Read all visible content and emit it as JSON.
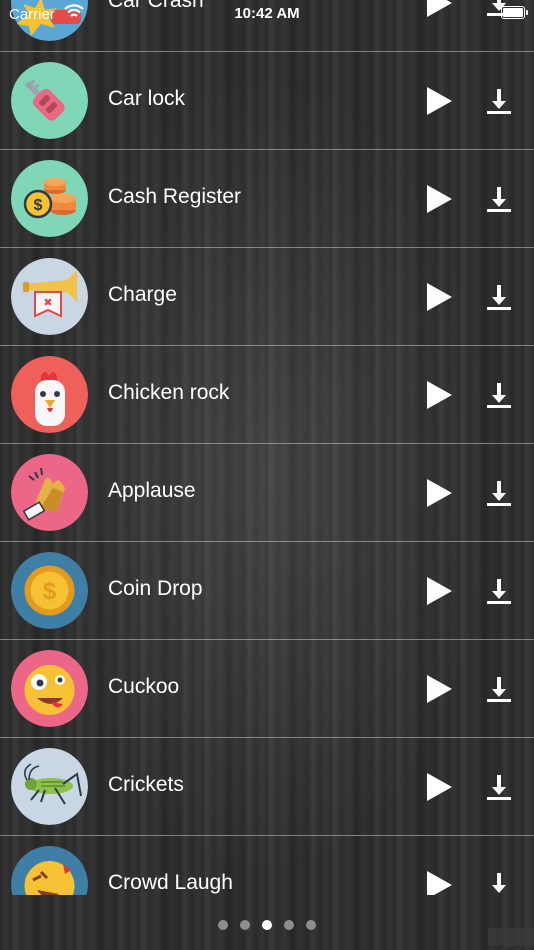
{
  "status_bar": {
    "carrier": "Carrier",
    "time": "10:42 AM"
  },
  "sounds": [
    {
      "label": "Car Crash",
      "icon": "car-crash-icon"
    },
    {
      "label": "Car lock",
      "icon": "car-key-icon"
    },
    {
      "label": "Cash Register",
      "icon": "coins-icon"
    },
    {
      "label": "Charge",
      "icon": "bugle-icon"
    },
    {
      "label": "Chicken rock",
      "icon": "chicken-icon"
    },
    {
      "label": "Applause",
      "icon": "clapping-hands-icon"
    },
    {
      "label": "Coin Drop",
      "icon": "gold-coin-icon"
    },
    {
      "label": "Cuckoo",
      "icon": "crazy-face-icon"
    },
    {
      "label": "Crickets",
      "icon": "cricket-icon"
    },
    {
      "label": "Crowd Laugh",
      "icon": "laughing-face-icon"
    }
  ],
  "pager": {
    "count": 5,
    "active_index": 2
  }
}
